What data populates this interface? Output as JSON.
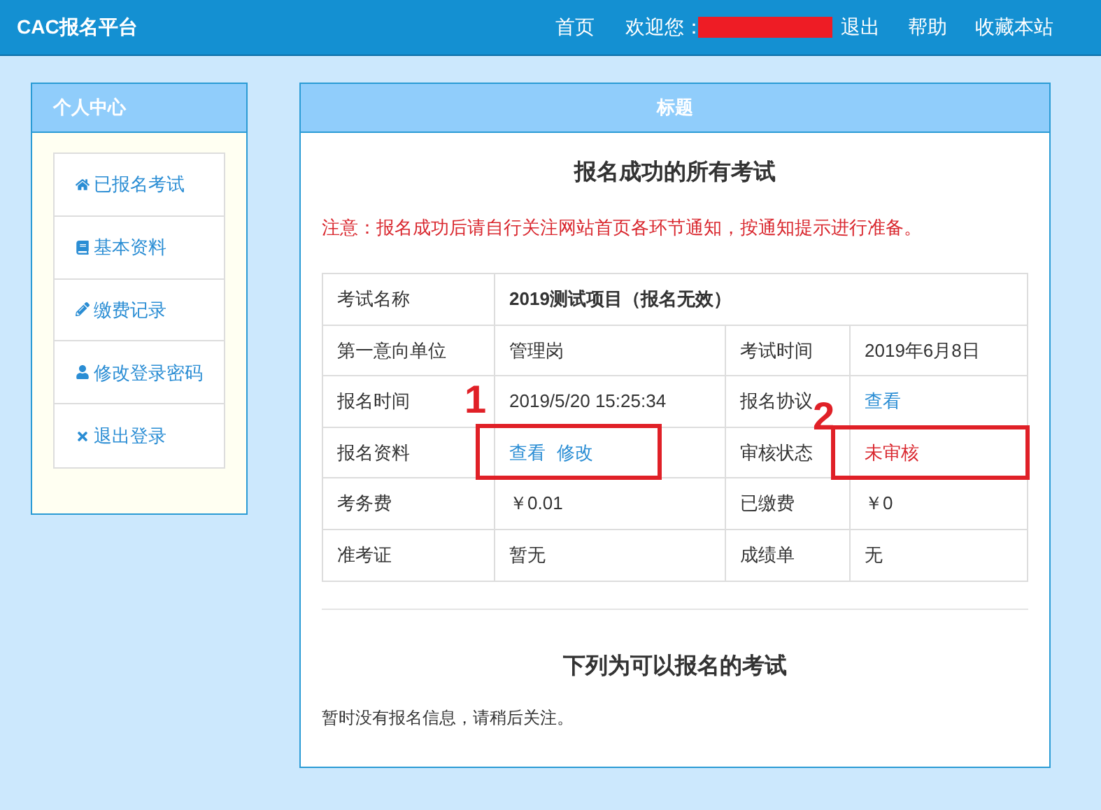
{
  "header": {
    "title": "CAC报名平台",
    "nav": [
      {
        "kind": "link",
        "text": "首页"
      },
      {
        "kind": "greeting",
        "text": "欢迎您："
      },
      {
        "kind": "redacted"
      },
      {
        "kind": "link",
        "text": "退出"
      },
      {
        "kind": "link",
        "text": "帮助"
      },
      {
        "kind": "link",
        "text": "收藏本站"
      }
    ]
  },
  "sidebar": {
    "title": "个人中心",
    "items": [
      {
        "label": "已报名考试"
      },
      {
        "label": "基本资料"
      },
      {
        "label": "缴费记录"
      },
      {
        "label": "修改登录密码"
      },
      {
        "label": "退出登录"
      }
    ]
  },
  "main": {
    "title": "标题",
    "heading": "报名成功的所有考试",
    "notice": "注意：报名成功后请自行关注网站首页各环节通知，按通知提示进行准备。",
    "table": {
      "rows": [
        [
          {
            "kind": "label",
            "text": "考试名称"
          },
          {
            "kind": "bold",
            "text": "2019测试项目（报名无效）",
            "colspan": 3
          }
        ],
        [
          {
            "kind": "label",
            "text": "第一意向单位"
          },
          {
            "kind": "text",
            "text": "管理岗"
          },
          {
            "kind": "label",
            "text": "考试时间"
          },
          {
            "kind": "text",
            "text": "2019年6月8日"
          }
        ],
        [
          {
            "kind": "label",
            "text": "报名时间"
          },
          {
            "kind": "text",
            "text": "2019/5/20 15:25:34"
          },
          {
            "kind": "label",
            "text": "报名协议"
          },
          {
            "kind": "links",
            "links": [
              "查看"
            ]
          }
        ],
        [
          {
            "kind": "label",
            "text": "报名资料"
          },
          {
            "kind": "links",
            "links": [
              "查看",
              "修改"
            ]
          },
          {
            "kind": "label",
            "text": "审核状态"
          },
          {
            "kind": "status",
            "text": "未审核"
          }
        ],
        [
          {
            "kind": "label",
            "text": "考务费"
          },
          {
            "kind": "text",
            "text": "￥0.01"
          },
          {
            "kind": "label",
            "text": "已缴费"
          },
          {
            "kind": "text",
            "text": "￥0"
          }
        ],
        [
          {
            "kind": "label",
            "text": "准考证"
          },
          {
            "kind": "text",
            "text": "暂无"
          },
          {
            "kind": "label",
            "text": "成绩单"
          },
          {
            "kind": "text",
            "text": "无"
          }
        ]
      ]
    },
    "heading2": "下列为可以报名的考试",
    "empty_text": "暂时没有报名信息，请稍后关注。"
  },
  "annotations": [
    {
      "number": "1"
    },
    {
      "number": "2"
    }
  ]
}
